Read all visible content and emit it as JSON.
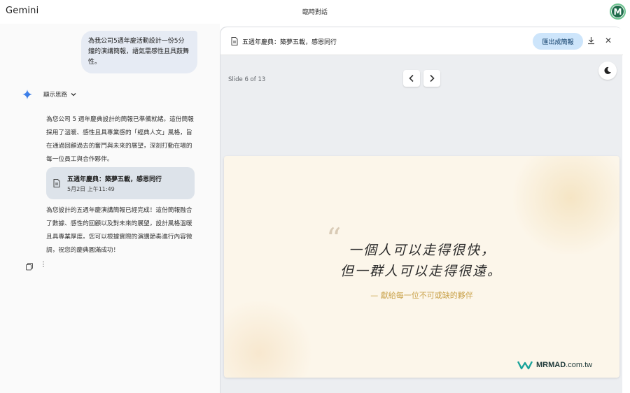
{
  "header": {
    "app_title": "Gemini",
    "chat_title": "臨時對話",
    "avatar_letter": "M"
  },
  "chat": {
    "user_prompt": "為我公司5週年慶活動設計一份5分鐘的演講簡報，語氣需感性且具鼓舞性。",
    "thoughts_label": "顯示思路",
    "response_intro": "為您公司 5 週年慶典設計的簡報已準備就緒。這份簡報採用了溫暖、感性且具專業感的「經典人文」風格，旨在通過回顧過去的奮鬥與未來的展望，深刻打動在場的每一位員工與合作夥伴。",
    "doc_card": {
      "title": "五週年慶典：築夢五載，感恩同行",
      "date": "5月2日 上午11:49"
    },
    "response_outro": "為您設計的五週年慶演講簡報已經完成！這份簡報融合了數據、感性的回顧以及對未來的展望，設計風格溫暖且具專業厚度。您可以根據實際的演講節奏進行內容微調，祝您的慶典圓滿成功！"
  },
  "canvas": {
    "title": "五週年慶典：築夢五載，感恩同行",
    "export_label": "匯出成簡報",
    "slide_counter": "Slide 6 of 13",
    "slide": {
      "quote_mark": "“",
      "quote_line1": "一個人可以走得很快，",
      "quote_line2": "但一群人可以走得很遠。",
      "dedication": "— 獻給每一位不可或缺的夥伴"
    }
  },
  "watermark": {
    "brand": "MRMAD",
    "domain": ".com.tw"
  },
  "colors": {
    "accent_button": "#cde5fb",
    "slide_background": "#fcf6ea",
    "dedication_gold": "#c9a24a",
    "avatar_green": "#1e6b4a"
  },
  "icons": [
    "gemini-spark-icon",
    "chevron-down-icon",
    "document-icon",
    "copy-icon",
    "more-vert-icon",
    "download-icon",
    "close-icon",
    "chevron-left-icon",
    "chevron-right-icon",
    "moon-icon",
    "mrmad-logo-icon"
  ]
}
